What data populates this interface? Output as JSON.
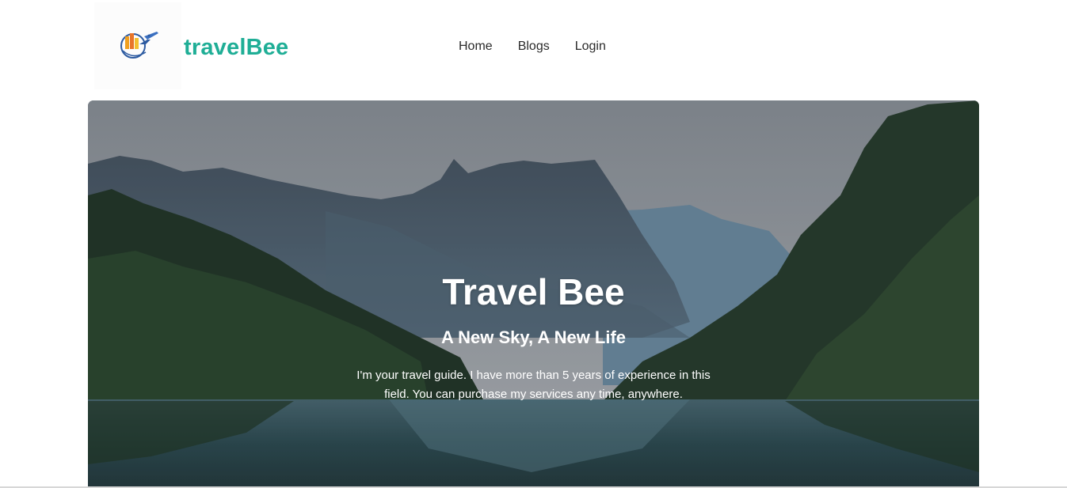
{
  "header": {
    "brand": "travelBee",
    "logo_icon": "travel-globe-plane-logo",
    "nav": {
      "home": "Home",
      "blogs": "Blogs",
      "login": "Login"
    }
  },
  "hero": {
    "title": "Travel Bee",
    "subtitle": "A New Sky, A New Life",
    "description": "I'm your travel guide. I have more than 5 years of experience in this field. You can purchase my services any time, anywhere.",
    "image_icon": "mountain-lake-forest-image"
  },
  "colors": {
    "brand": "#1fae96",
    "nav_text": "#2a2a2a",
    "hero_text": "#ffffff"
  }
}
